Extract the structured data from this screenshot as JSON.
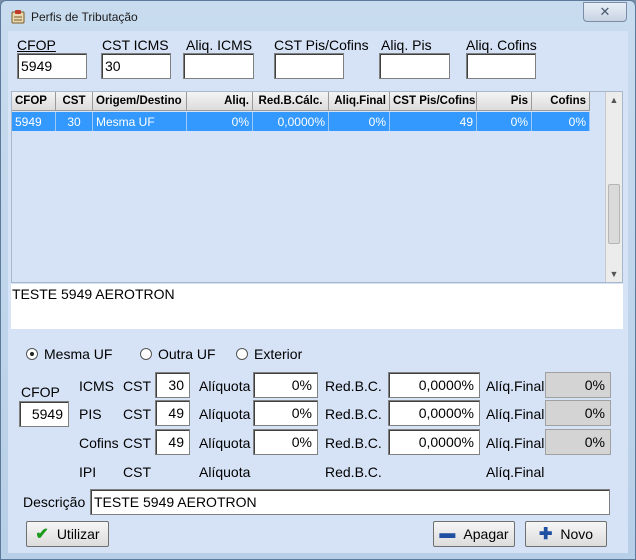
{
  "window": {
    "title": "Perfis de Tributação",
    "close_label": "✕"
  },
  "filters": [
    {
      "label": "CFOP",
      "value": "5949"
    },
    {
      "label": "CST ICMS",
      "value": "30"
    },
    {
      "label": "Aliq. ICMS",
      "value": ""
    },
    {
      "label": "CST Pis/Cofins",
      "value": ""
    },
    {
      "label": "Aliq. Pis",
      "value": ""
    },
    {
      "label": "Aliq. Cofins",
      "value": ""
    }
  ],
  "grid": {
    "columns": [
      "CFOP",
      "CST",
      "Origem/Destino",
      "Aliq.",
      "Red.B.Cálc.",
      "Aliq.Final",
      "CST Pis/Cofins",
      "Pis",
      "Cofins"
    ],
    "rows": [
      [
        "5949",
        "30",
        "Mesma UF",
        "0%",
        "0,0000%",
        "0%",
        "49",
        "0%",
        "0%"
      ]
    ]
  },
  "memo": "TESTE 5949 AEROTRON",
  "origin": {
    "options": [
      "Mesma UF",
      "Outra UF",
      "Exterior"
    ],
    "selected": "Mesma UF"
  },
  "detail": {
    "cfop_label": "CFOP",
    "cfop_value": "5949",
    "cst_label": "CST",
    "aliquota_label": "Alíquota",
    "redbc_label": "Red.B.C.",
    "aliqfinal_label": "Alíq.Final",
    "taxes": [
      {
        "name": "ICMS",
        "cst": "30",
        "aliquota": "0%",
        "redbc": "0,0000%",
        "final": "0%"
      },
      {
        "name": "PIS",
        "cst": "49",
        "aliquota": "0%",
        "redbc": "0,0000%",
        "final": "0%"
      },
      {
        "name": "Cofins",
        "cst": "49",
        "aliquota": "0%",
        "redbc": "0,0000%",
        "final": "0%"
      },
      {
        "name": "IPI"
      }
    ],
    "descricao_label": "Descrição",
    "descricao_value": "TESTE 5949 AEROTRON"
  },
  "buttons": {
    "utilizar": "Utilizar",
    "apagar": "Apagar",
    "novo": "Novo"
  }
}
